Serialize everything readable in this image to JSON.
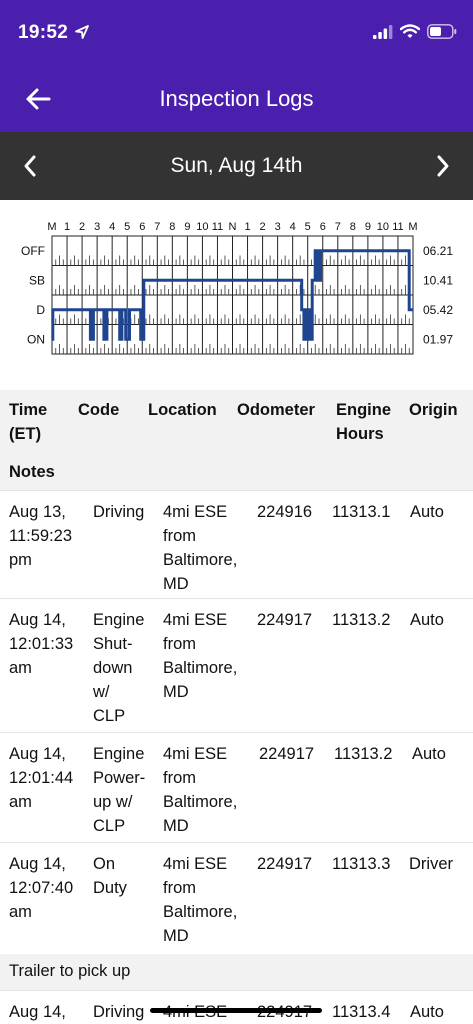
{
  "status": {
    "time": "19:52"
  },
  "nav": {
    "title": "Inspection Logs"
  },
  "date_bar": {
    "date": "Sun, Aug 14th"
  },
  "chart_data": {
    "type": "line",
    "hour_labels": [
      "M",
      "1",
      "2",
      "3",
      "4",
      "5",
      "6",
      "7",
      "8",
      "9",
      "10",
      "11",
      "N",
      "1",
      "2",
      "3",
      "4",
      "5",
      "6",
      "7",
      "8",
      "9",
      "10",
      "11",
      "M"
    ],
    "status_rows": [
      "OFF",
      "SB",
      "D",
      "ON"
    ],
    "totals": [
      "06.21",
      "10.41",
      "05.42",
      "01.97"
    ],
    "segments": [
      {
        "from": 0.0,
        "to": 0.05,
        "status": "ON"
      },
      {
        "from": 0.05,
        "to": 2.55,
        "status": "D"
      },
      {
        "from": 2.55,
        "to": 2.75,
        "status": "ON"
      },
      {
        "from": 2.75,
        "to": 3.45,
        "status": "D"
      },
      {
        "from": 3.45,
        "to": 3.65,
        "status": "ON"
      },
      {
        "from": 3.65,
        "to": 4.5,
        "status": "D"
      },
      {
        "from": 4.5,
        "to": 4.65,
        "status": "ON"
      },
      {
        "from": 4.65,
        "to": 4.9,
        "status": "D"
      },
      {
        "from": 4.9,
        "to": 5.15,
        "status": "ON"
      },
      {
        "from": 5.15,
        "to": 5.9,
        "status": "D"
      },
      {
        "from": 5.9,
        "to": 6.1,
        "status": "ON"
      },
      {
        "from": 6.1,
        "to": 16.6,
        "status": "SB"
      },
      {
        "from": 16.6,
        "to": 16.75,
        "status": "D"
      },
      {
        "from": 16.75,
        "to": 16.9,
        "status": "ON"
      },
      {
        "from": 16.9,
        "to": 17.1,
        "status": "D"
      },
      {
        "from": 17.1,
        "to": 17.3,
        "status": "ON"
      },
      {
        "from": 17.3,
        "to": 17.5,
        "status": "SB"
      },
      {
        "from": 17.5,
        "to": 17.7,
        "status": "OFF"
      },
      {
        "from": 17.7,
        "to": 17.85,
        "status": "SB"
      },
      {
        "from": 17.85,
        "to": 23.75,
        "status": "OFF"
      },
      {
        "from": 23.75,
        "to": 24.0,
        "status": "D"
      }
    ]
  },
  "table": {
    "headers": {
      "time": "Time\n(ET)",
      "code": "Code",
      "location": "Location",
      "odometer": "Odometer",
      "engine_hours": "Engine\nHours",
      "origin": "Origin",
      "notes": "Notes"
    },
    "rows": [
      {
        "time": "Aug 13,\n11:59:23\npm",
        "code": "Driving",
        "location": "4mi ESE\nfrom\nBaltimore,\nMD",
        "odometer": "224916",
        "engine_hours": "11313.1",
        "origin": "Auto",
        "note": ""
      },
      {
        "time": "Aug 14,\n12:01:33\nam",
        "code": "Engine\nShut-\ndown\nw/\nCLP",
        "location": "4mi ESE\nfrom\nBaltimore,\nMD",
        "odometer": "224917",
        "engine_hours": "11313.2",
        "origin": "Auto",
        "note": ""
      },
      {
        "time": "Aug 14,\n12:01:44\nam",
        "code": "Engine\nPower-\nup w/\nCLP",
        "location": "4mi ESE\nfrom\nBaltimore,\nMD",
        "odometer": "224917",
        "engine_hours": "11313.2",
        "origin": "Auto",
        "note": ""
      },
      {
        "time": "Aug 14,\n12:07:40\nam",
        "code": "On\nDuty",
        "location": "4mi ESE\nfrom\nBaltimore,\nMD",
        "odometer": "224917",
        "engine_hours": "11313.3",
        "origin": "Driver",
        "note": "Trailer to pick up"
      },
      {
        "time": "Aug 14,",
        "code": "Driving",
        "location": "4mi ESE",
        "odometer": "224917",
        "engine_hours": "11313.4",
        "origin": "Auto",
        "note": ""
      }
    ]
  }
}
